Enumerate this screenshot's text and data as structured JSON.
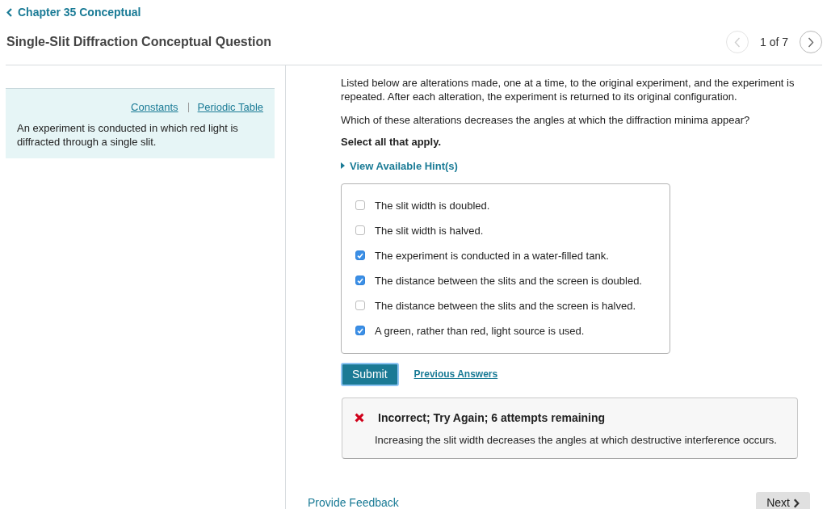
{
  "breadcrumb": {
    "label": "Chapter 35 Conceptual"
  },
  "header": {
    "title": "Single-Slit Diffraction Conceptual Question",
    "pager": {
      "position": "1 of 7",
      "prev": {
        "disabled": true
      },
      "next": {
        "disabled": false
      }
    }
  },
  "sidebar": {
    "links": [
      "Constants",
      "Periodic Table"
    ],
    "text": "An experiment is conducted in which red light is diffracted through a single slit."
  },
  "question": {
    "paragraphs": [
      "Listed below are alterations made, one at a time, to the original experiment, and the experiment is repeated. After each alteration, the experiment is returned to its original configuration.",
      "Which of these alterations decreases the angles at which the diffraction minima appear?"
    ],
    "instruction": "Select all that apply.",
    "hint": {
      "label": "View Available Hint(s)",
      "expanded": false
    },
    "options": [
      {
        "label": "The slit width is doubled.",
        "checked": false
      },
      {
        "label": "The slit width is halved.",
        "checked": false
      },
      {
        "label": "The experiment is conducted in a water-filled tank.",
        "checked": true
      },
      {
        "label": "The distance between the slits and the screen is doubled.",
        "checked": true
      },
      {
        "label": "The distance between the slits and the screen is halved.",
        "checked": false
      },
      {
        "label": "A green, rather than red, light source is used.",
        "checked": true
      }
    ]
  },
  "actions": {
    "submit": {
      "label": "Submit",
      "focused": true
    },
    "previous_answers": "Previous Answers"
  },
  "feedback": {
    "kind": "incorrect",
    "title": "Incorrect; Try Again; 6 attempts remaining",
    "message": "Increasing the slit width decreases the angles at which destructive interference occurs."
  },
  "footer": {
    "feedback_link": "Provide Feedback",
    "next": "Next"
  }
}
